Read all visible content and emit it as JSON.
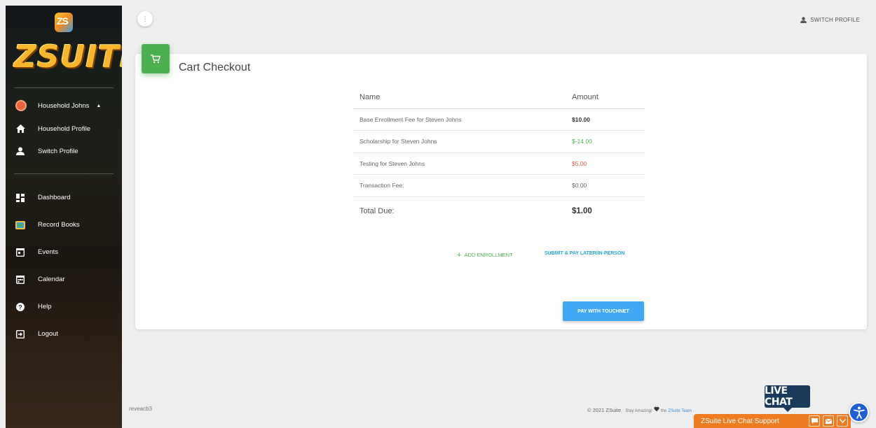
{
  "app": {
    "logo_badge": "ZS",
    "logo_text": "ZSUITE"
  },
  "sidebar": {
    "user_name": "Household Johns",
    "profile_items": [
      {
        "label": "Household Profile",
        "icon": "home-icon"
      },
      {
        "label": "Switch Profile",
        "icon": "person-icon"
      }
    ],
    "nav_items": [
      {
        "label": "Dashboard",
        "icon": "dashboard-icon"
      },
      {
        "label": "Record Books",
        "icon": "record-books-icon"
      },
      {
        "label": "Events",
        "icon": "events-icon"
      },
      {
        "label": "Calendar",
        "icon": "calendar-icon"
      },
      {
        "label": "Help",
        "icon": "help-icon"
      },
      {
        "label": "Logout",
        "icon": "logout-icon"
      }
    ]
  },
  "topbar": {
    "menu_icon": "⋮",
    "switch_profile": "SWITCH PROFILE"
  },
  "checkout": {
    "title": "Cart Checkout",
    "columns": {
      "name": "Name",
      "amount": "Amount"
    },
    "rows": [
      {
        "name": "Base Enrollment Fee for Steven Johns",
        "amount": "$10.00",
        "style": "bold"
      },
      {
        "name": "Scholarship for Steven Johns",
        "amount": "$-14.00",
        "style": "green"
      },
      {
        "name": "Testing for Steven Johns",
        "amount": "$5.00",
        "style": "red"
      },
      {
        "name": "Transaction Fee:",
        "amount": "$0.00",
        "style": "plain"
      }
    ],
    "total_label": "Total Due:",
    "total_amount": "$1.00",
    "add_enrollment": "ADD ENROLLMENT",
    "submit_later": "SUBMIT & PAY LATER/IN-PERSON",
    "pay_button": "PAY WITH TOUCHNET"
  },
  "footer": {
    "version": "reveacb3",
    "copyright": "© 2021 ZSuite",
    "tagline_prefix": "Stay Amazing!",
    "tagline_mid": "the",
    "team_link": "ZSuite Team"
  },
  "chat": {
    "bubble": "LIVE CHAT",
    "bar_label": "ZSuite Live Chat Support"
  },
  "colors": {
    "accent_green": "#4caf50",
    "link_blue": "#26a5d6",
    "pay_blue": "#3fa9f5",
    "negative_red": "#e8554e",
    "chat_orange": "#f07c22"
  }
}
